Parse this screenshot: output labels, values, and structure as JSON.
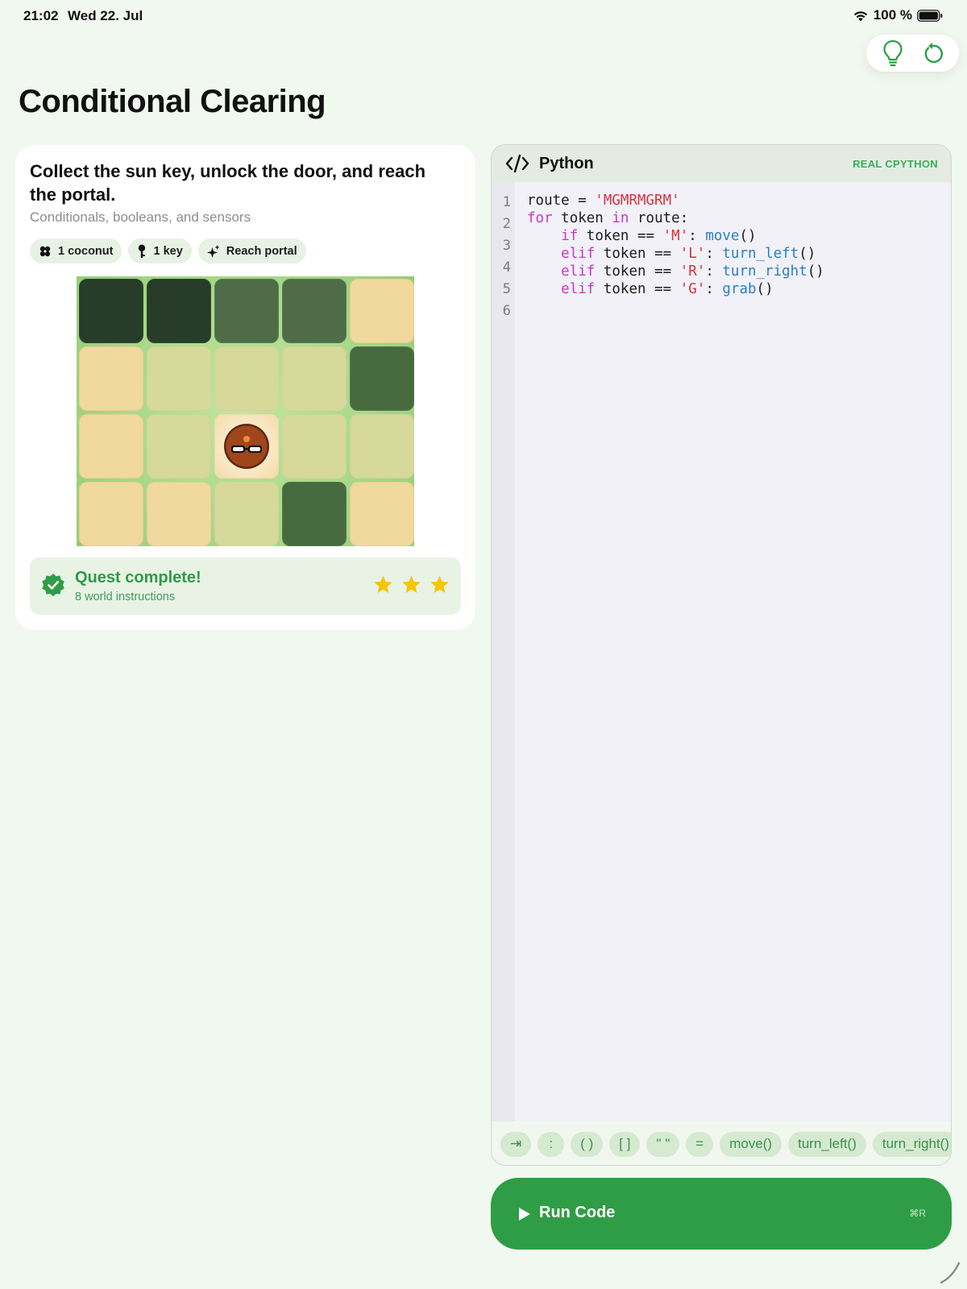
{
  "status_bar": {
    "time": "21:02",
    "date": "Wed 22. Jul",
    "battery": "100 %",
    "icons": [
      "wifi-icon",
      "battery-icon"
    ]
  },
  "toolbar": {
    "buttons": [
      {
        "name": "hint-button",
        "icon": "lightbulb-icon"
      },
      {
        "name": "reset-button",
        "icon": "reset-icon"
      }
    ]
  },
  "page": {
    "title": "Conditional Clearing"
  },
  "quest": {
    "title": "Collect the sun key, unlock the door, and reach the portal.",
    "subtitle": "Conditionals, booleans, and sensors",
    "chips": [
      {
        "icon": "coconut-icon",
        "label": "1 coconut"
      },
      {
        "icon": "key-icon",
        "label": "1 key"
      },
      {
        "icon": "sparkle-icon",
        "label": "Reach portal"
      }
    ],
    "board": {
      "rows": 4,
      "cols": 5,
      "tiles": [
        [
          "dark",
          "dark",
          "mid",
          "mid",
          "sand"
        ],
        [
          "sand",
          "pale",
          "pale",
          "pale",
          "midd"
        ],
        [
          "sand",
          "pale",
          "robot",
          "pale",
          "pale"
        ],
        [
          "sand",
          "sand",
          "pale",
          "midd",
          "sand"
        ]
      ],
      "robot_position": {
        "row": 2,
        "col": 2
      }
    },
    "status": {
      "title": "Quest complete!",
      "subtitle": "8 world instructions",
      "stars": 3,
      "stars_max": 3
    }
  },
  "editor": {
    "language": "Python",
    "engine": "REAL CPYTHON",
    "line_numbers": [
      "1",
      "2",
      "3",
      "4",
      "5",
      "6"
    ],
    "code_lines": [
      "route = 'MGMRMGRM'",
      "for token in route:",
      "    if token == 'M': move()",
      "    elif token == 'L': turn_left()",
      "    elif token == 'R': turn_right()",
      "    elif token == 'G': grab()",
      ""
    ],
    "snippets": [
      "⇥",
      ":",
      "( )",
      "[ ]",
      "\" \"",
      "=",
      "move()",
      "turn_left()",
      "turn_right()"
    ]
  },
  "run_button": {
    "label": "Run Code",
    "shortcut": "⌘R"
  },
  "colors": {
    "background": "#f1f8ef",
    "accent": "#2f9d45",
    "keyword": "#c936c9",
    "string": "#d8323c",
    "function": "#2a7fc7",
    "star": "#f7c400"
  }
}
